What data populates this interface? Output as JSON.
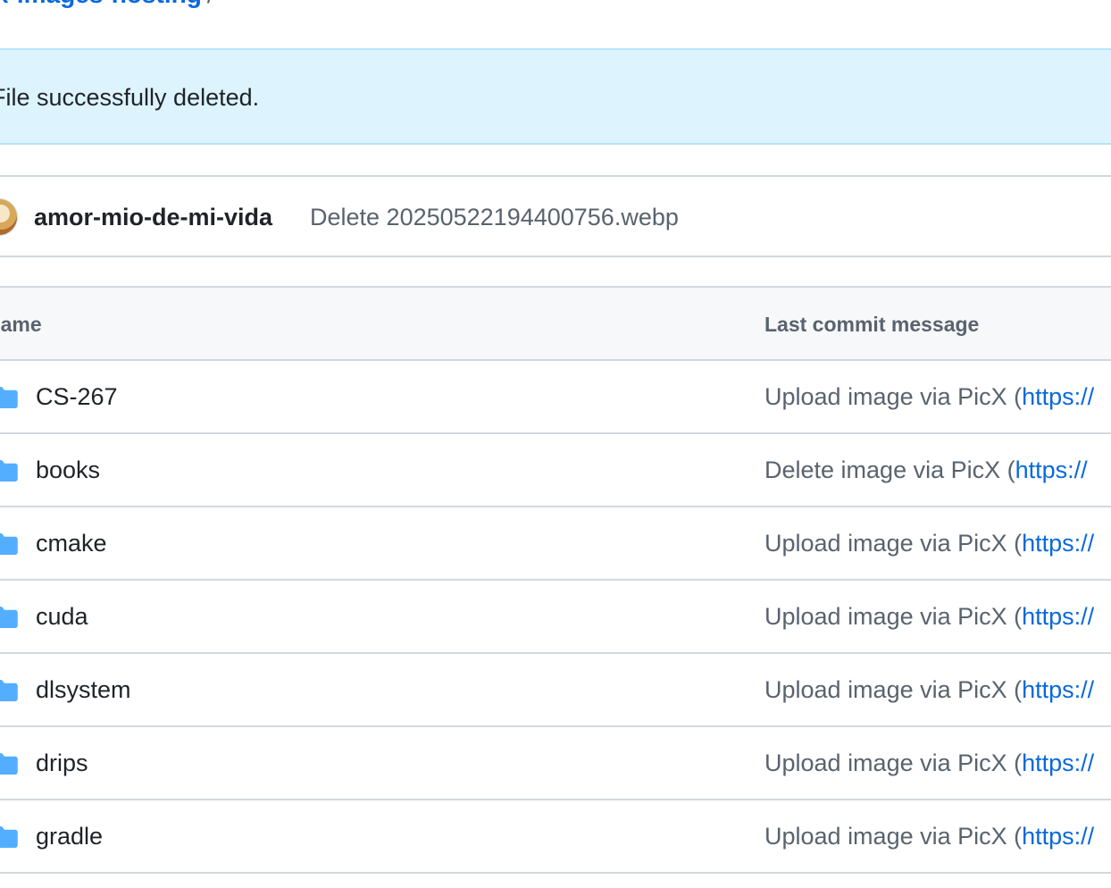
{
  "breadcrumb": {
    "repo_link": "x-images-hosting",
    "separator": "/"
  },
  "flash": {
    "message": "File successfully deleted."
  },
  "latest_commit": {
    "author": "amor-mio-de-mi-vida",
    "message": "Delete 20250522194400756.webp"
  },
  "table": {
    "headers": {
      "name": "Name",
      "last_commit_message": "Last commit message"
    },
    "rows": [
      {
        "name": "CS-267",
        "message": "Upload image via PicX (",
        "url": "https://"
      },
      {
        "name": "books",
        "message": "Delete image via PicX (",
        "url": "https://"
      },
      {
        "name": "cmake",
        "message": "Upload image via PicX (",
        "url": "https://"
      },
      {
        "name": "cuda",
        "message": "Upload image via PicX (",
        "url": "https://"
      },
      {
        "name": "dlsystem",
        "message": "Upload image via PicX (",
        "url": "https://"
      },
      {
        "name": "drips",
        "message": "Upload image via PicX (",
        "url": "https://"
      },
      {
        "name": "gradle",
        "message": "Upload image via PicX (",
        "url": "https://"
      }
    ]
  },
  "colors": {
    "link": "#0969da",
    "folder": "#54aeff",
    "flash_bg": "#ddf4ff",
    "muted_text": "#59636e"
  },
  "icons": {
    "folder": "folder-icon",
    "avatar": "avatar"
  }
}
